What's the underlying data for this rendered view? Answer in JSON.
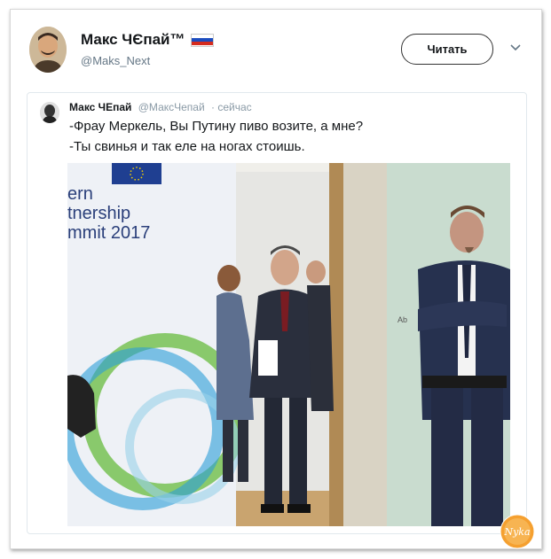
{
  "tweet": {
    "author_name": "Макс ЧЄпай™",
    "author_handle": "@Maks_Next",
    "follow_label": "Читать"
  },
  "quoted": {
    "name": "Макс ЧЕпай",
    "handle": "@МаксЧепай",
    "time": "· сейчас",
    "lines": [
      "-Фрау Меркель, Вы Путину пиво возите, а мне?",
      "-Ты свинья и так еле на ногах стоишь."
    ],
    "image": {
      "banner_lines": [
        "ern",
        "tnership",
        "mmit 2017"
      ],
      "small_sign": "Ab"
    }
  },
  "watermark_text": "Nyka",
  "icons": {
    "menu": "chevron-down-icon",
    "flag": "russia-flag-icon"
  },
  "colors": {
    "text": "#14171a",
    "muted": "#657786",
    "border": "#e1e8ed",
    "flag": [
      "#ffffff",
      "#1c4dbf",
      "#d52b1e"
    ]
  }
}
